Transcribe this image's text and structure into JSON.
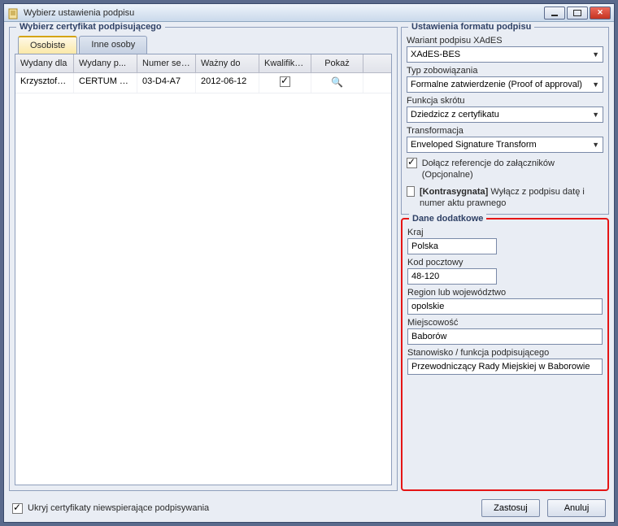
{
  "window": {
    "title": "Wybierz ustawienia podpisu"
  },
  "certPanel": {
    "legend": "Wybierz certyfikat podpisującego",
    "tabs": {
      "personal": "Osobiste",
      "others": "Inne osoby"
    },
    "columns": {
      "issuedTo": "Wydany dla",
      "issuedBy": "Wydany p...",
      "serial": "Numer ser...",
      "validTo": "Ważny do",
      "qualified": "Kwalifiko...",
      "show": "Pokaż"
    },
    "rows": [
      {
        "issuedTo": "Krzysztof R...",
        "issuedBy": "CERTUM QCA",
        "serial": "03-D4-A7",
        "validTo": "2012-06-12",
        "qualified": true
      }
    ]
  },
  "formatPanel": {
    "legend": "Ustawienia formatu podpisu",
    "variantLabel": "Wariant podpisu XAdES",
    "variantValue": "XAdES-BES",
    "commitmentLabel": "Typ zobowiązania",
    "commitmentValue": "Formalne zatwierdzenie (Proof of approval)",
    "hashLabel": "Funkcja skrótu",
    "hashValue": "Dziedzicz z certyfikatu",
    "transformLabel": "Transformacja",
    "transformValue": "Enveloped Signature Transform",
    "attachRefs": {
      "checked": true,
      "label": "Dołącz referencje do załączników (Opcjonalne)"
    },
    "contrasign": {
      "checked": false,
      "bold": "[Kontrasygnata]",
      "label": " Wyłącz z podpisu datę i numer aktu prawnego"
    }
  },
  "extraPanel": {
    "legend": "Dane dodatkowe",
    "countryLabel": "Kraj",
    "countryValue": "Polska",
    "zipLabel": "Kod pocztowy",
    "zipValue": "48-120",
    "regionLabel": "Region lub województwo",
    "regionValue": "opolskie",
    "cityLabel": "Miejscowość",
    "cityValue": "Baborów",
    "roleLabel": "Stanowisko / funkcja podpisującego",
    "roleValue": "Przewodniczący Rady Miejskiej w Baborowie"
  },
  "footer": {
    "hideUnsupported": {
      "checked": true,
      "label": "Ukryj certyfikaty niewspierające podpisywania"
    },
    "apply": "Zastosuj",
    "cancel": "Anuluj"
  }
}
